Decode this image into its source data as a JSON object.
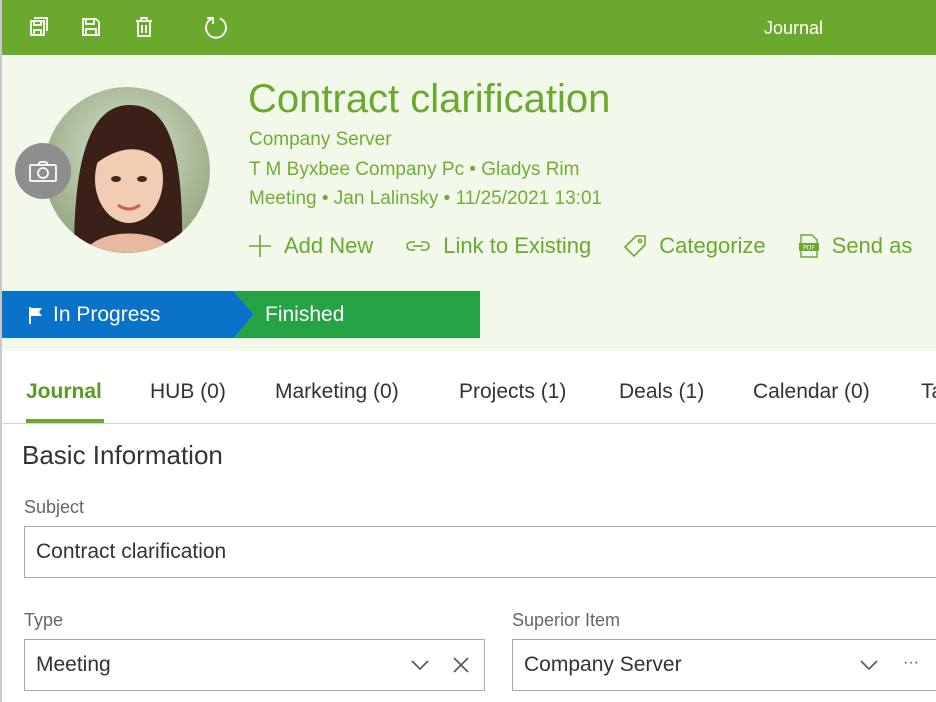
{
  "toolbar": {
    "title": "Journal",
    "buttons": [
      "save-and-close-icon",
      "save-icon",
      "delete-icon",
      "refresh-icon"
    ]
  },
  "header": {
    "title": "Contract clarification",
    "line1": "Company Server",
    "line2": "T M Byxbee Company Pc • Gladys Rim",
    "line3": "Meeting • Jan Lalinsky • 11/25/2021 13:01",
    "actions": {
      "add_new": "Add New",
      "link_existing": "Link to Existing",
      "categorize": "Categorize",
      "send_as": "Send as"
    }
  },
  "status": {
    "in_progress": "In Progress",
    "finished": "Finished"
  },
  "tabs": [
    {
      "label": "Journal"
    },
    {
      "label": "HUB (0)"
    },
    {
      "label": "Marketing (0)"
    },
    {
      "label": "Projects (1)"
    },
    {
      "label": "Deals (1)"
    },
    {
      "label": "Calendar (0)"
    },
    {
      "label": "Ta"
    }
  ],
  "form": {
    "section_title": "Basic Information",
    "subject_label": "Subject",
    "subject_value": "Contract clarification",
    "type_label": "Type",
    "type_value": "Meeting",
    "superior_label": "Superior Item",
    "superior_value": "Company Server",
    "more_label": "···"
  },
  "colors": {
    "brand_green": "#6aa82e",
    "header_bg": "#f2f9ea",
    "in_progress_blue": "#0a72c9",
    "finished_green": "#25a244"
  }
}
